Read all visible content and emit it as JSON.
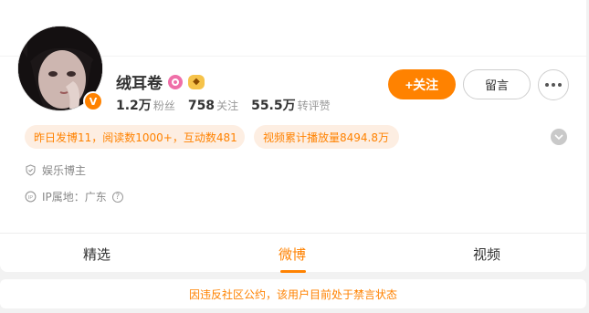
{
  "profile": {
    "name": "绒耳卷",
    "verified_badge": "V",
    "stats": [
      {
        "num": "1.2万",
        "label": "粉丝"
      },
      {
        "num": "758",
        "label": "关注"
      },
      {
        "num": "55.5万",
        "label": "转评赞"
      }
    ]
  },
  "actions": {
    "follow": "+关注",
    "message": "留言"
  },
  "pills": {
    "activity": "昨日发博11，阅读数1000+，互动数481",
    "video": "视频累计播放量8494.8万"
  },
  "info": {
    "category": "娱乐博主",
    "ip": "IP属地：广东",
    "help": "?"
  },
  "tabs": [
    "精选",
    "微博",
    "视频"
  ],
  "notice": "因违反社区公约，该用户目前处于禁言状态",
  "colors": {
    "accent": "#ff8200",
    "pill_bg": "#fdeee2"
  }
}
